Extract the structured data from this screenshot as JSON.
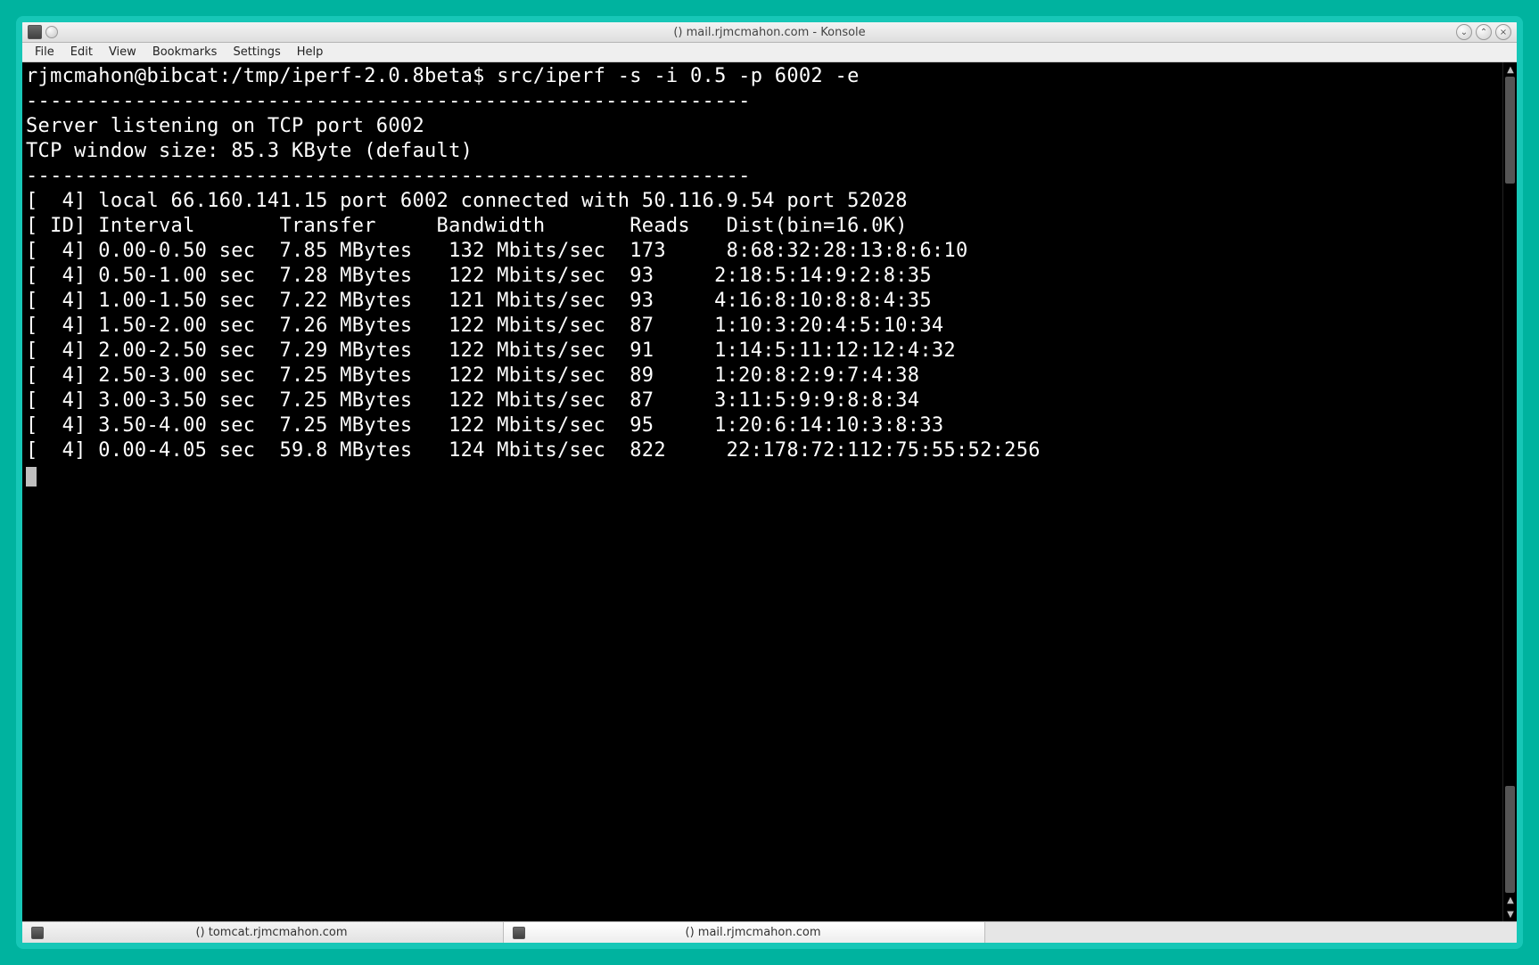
{
  "window": {
    "title": "() mail.rjmcmahon.com - Konsole"
  },
  "window_controls": {
    "minimize_glyph": "⌄",
    "maximize_glyph": "⌃",
    "close_glyph": "×"
  },
  "menubar": {
    "items": [
      {
        "label": "File"
      },
      {
        "label": "Edit"
      },
      {
        "label": "View"
      },
      {
        "label": "Bookmarks"
      },
      {
        "label": "Settings"
      },
      {
        "label": "Help"
      }
    ]
  },
  "terminal": {
    "prompt": "rjmcmahon@bibcat:/tmp/iperf-2.0.8beta$ ",
    "command": "src/iperf -s -i 0.5 -p 6002 -e",
    "divider": "------------------------------------------------------------",
    "server_line": "Server listening on TCP port 6002",
    "window_line": "TCP window size: 85.3 KByte (default)",
    "conn_line": "[  4] local 66.160.141.15 port 6002 connected with 50.116.9.54 port 52028",
    "header_line": "[ ID] Interval       Transfer     Bandwidth       Reads   Dist(bin=16.0K)",
    "rows": [
      "[  4] 0.00-0.50 sec  7.85 MBytes   132 Mbits/sec  173     8:68:32:28:13:8:6:10",
      "[  4] 0.50-1.00 sec  7.28 MBytes   122 Mbits/sec  93     2:18:5:14:9:2:8:35",
      "[  4] 1.00-1.50 sec  7.22 MBytes   121 Mbits/sec  93     4:16:8:10:8:8:4:35",
      "[  4] 1.50-2.00 sec  7.26 MBytes   122 Mbits/sec  87     1:10:3:20:4:5:10:34",
      "[  4] 2.00-2.50 sec  7.29 MBytes   122 Mbits/sec  91     1:14:5:11:12:12:4:32",
      "[  4] 2.50-3.00 sec  7.25 MBytes   122 Mbits/sec  89     1:20:8:2:9:7:4:38",
      "[  4] 3.00-3.50 sec  7.25 MBytes   122 Mbits/sec  87     3:11:5:9:9:8:8:34",
      "[  4] 3.50-4.00 sec  7.25 MBytes   122 Mbits/sec  95     1:20:6:14:10:3:8:33",
      "[  4] 0.00-4.05 sec  59.8 MBytes   124 Mbits/sec  822     22:178:72:112:75:55:52:256"
    ]
  },
  "scrollbar": {
    "up_glyph": "▲",
    "down_glyph": "▼"
  },
  "tabs": [
    {
      "label": "() tomcat.rjmcmahon.com",
      "active": false
    },
    {
      "label": "() mail.rjmcmahon.com",
      "active": true
    }
  ],
  "colors": {
    "desktop_bg": "#00b39f",
    "window_border": "#17c7b7",
    "terminal_bg": "#000000",
    "terminal_fg": "#ffffff"
  }
}
